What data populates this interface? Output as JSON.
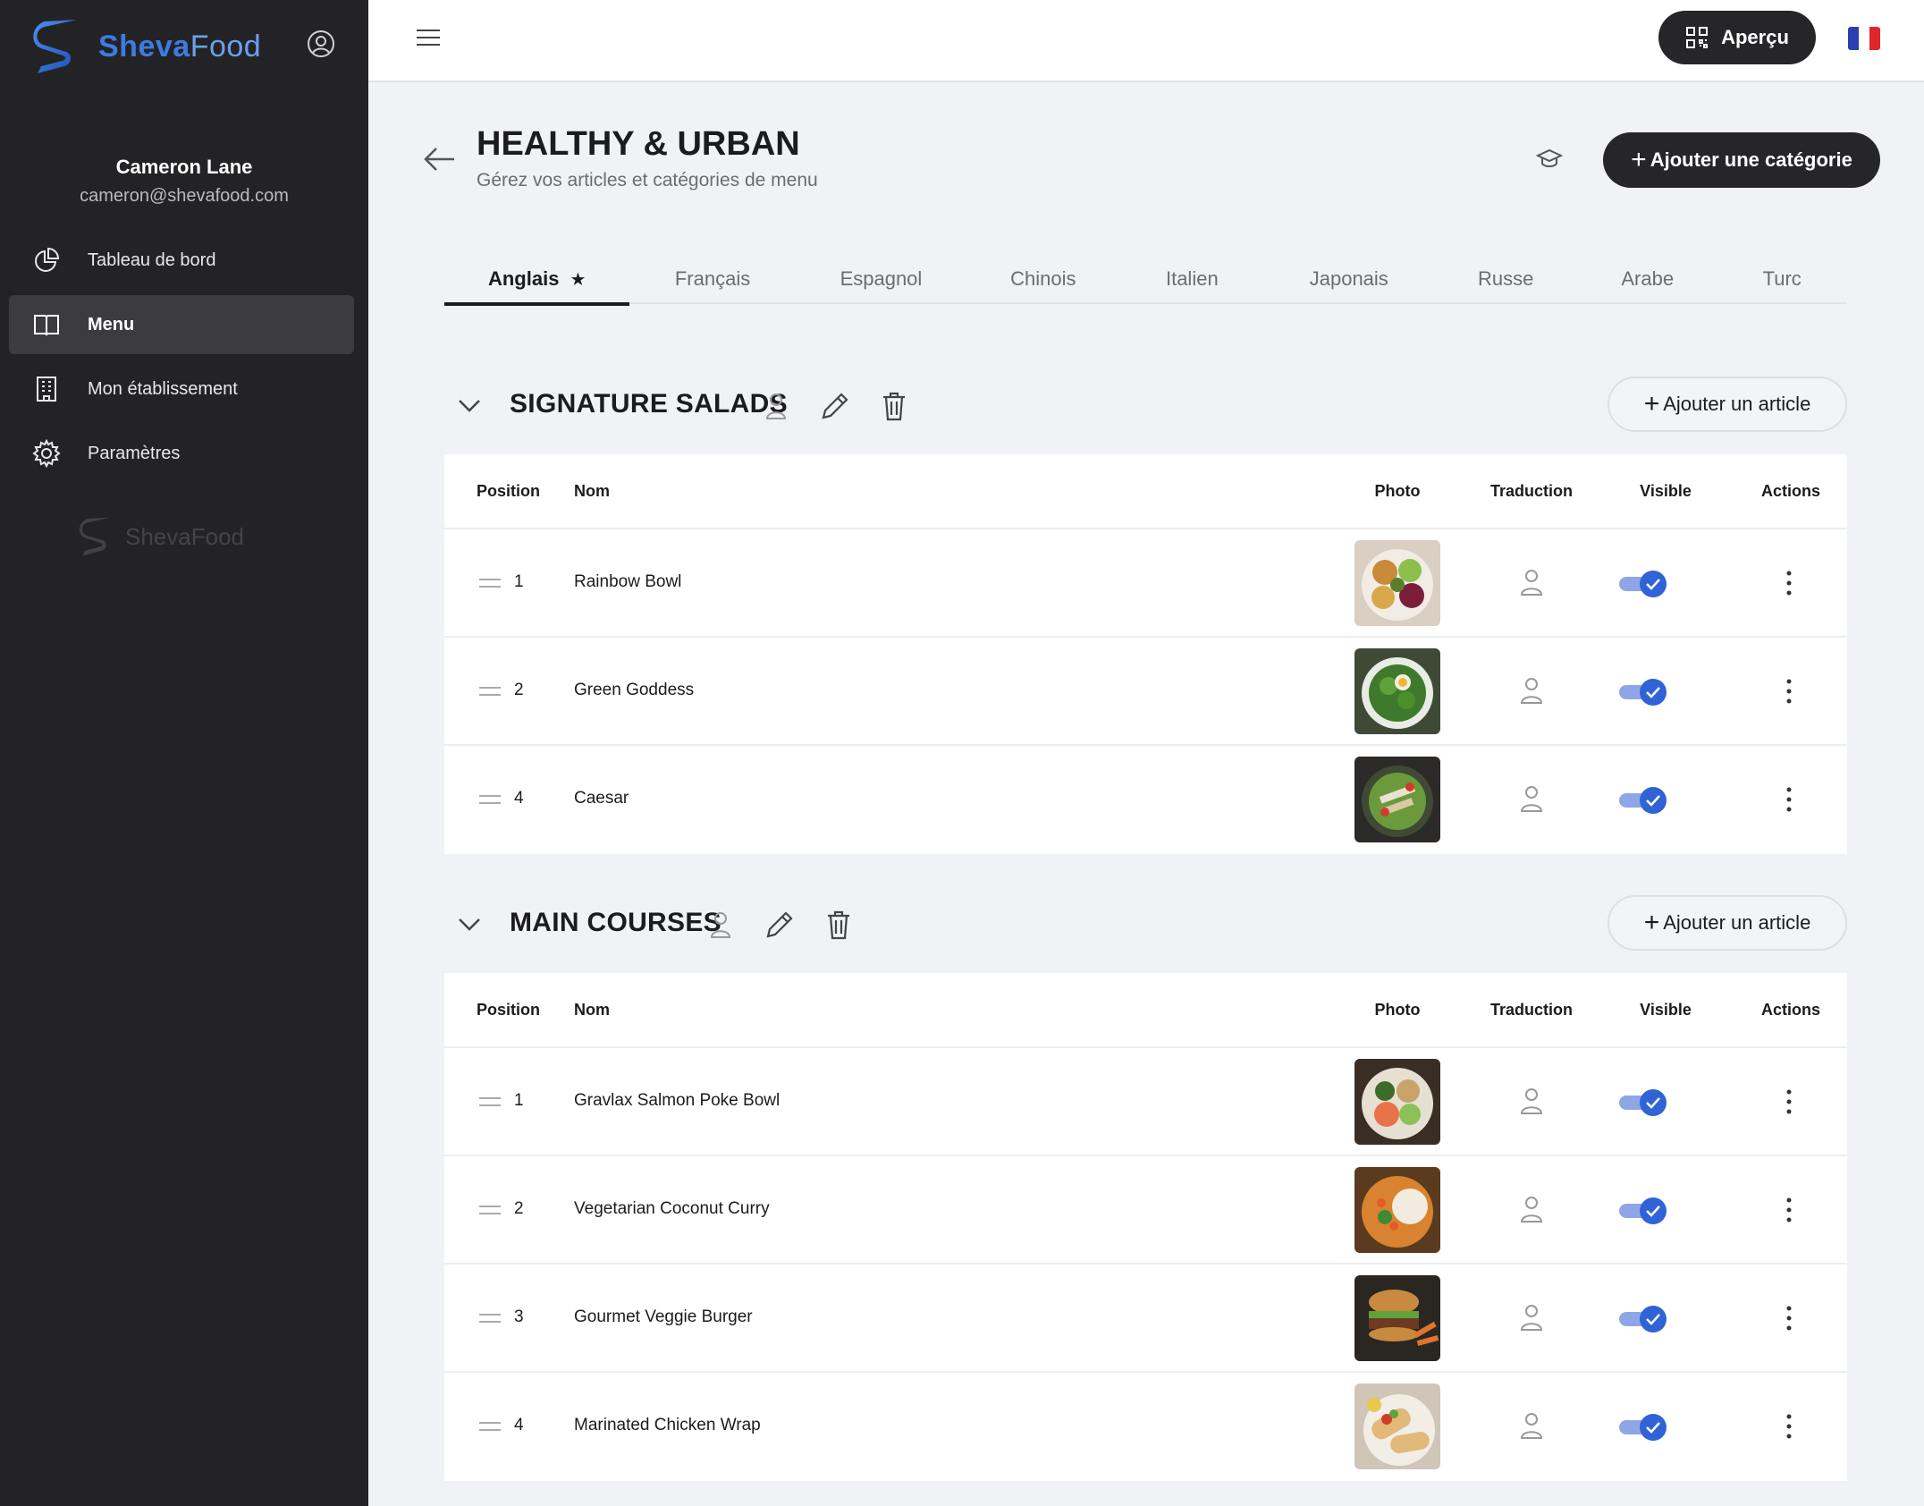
{
  "brand": {
    "name_part1": "Sheva",
    "name_part2": "Food"
  },
  "user": {
    "name": "Cameron Lane",
    "email": "cameron@shevafood.com"
  },
  "nav": [
    {
      "label": "Tableau de bord",
      "icon": "pie-chart-icon",
      "active": false
    },
    {
      "label": "Menu",
      "icon": "book-icon",
      "active": true
    },
    {
      "label": "Mon établissement",
      "icon": "building-icon",
      "active": false
    },
    {
      "label": "Paramètres",
      "icon": "gear-icon",
      "active": false
    }
  ],
  "topbar": {
    "preview_label": "Aperçu",
    "language_flag": "fr"
  },
  "header": {
    "title": "HEALTHY & URBAN",
    "subtitle": "Gérez vos articles et catégories de menu",
    "add_category_label": "Ajouter une catégorie"
  },
  "tabs": [
    {
      "label": "Anglais",
      "active": true,
      "default_star": "★"
    },
    {
      "label": "Français"
    },
    {
      "label": "Espagnol"
    },
    {
      "label": "Chinois"
    },
    {
      "label": "Italien"
    },
    {
      "label": "Japonais"
    },
    {
      "label": "Russe"
    },
    {
      "label": "Arabe"
    },
    {
      "label": "Turc"
    }
  ],
  "table_headers": {
    "position": "Position",
    "name": "Nom",
    "photo": "Photo",
    "translation": "Traduction",
    "visible": "Visible",
    "actions": "Actions"
  },
  "add_article_label": "Ajouter un article",
  "sections": [
    {
      "title": "SIGNATURE SALADS",
      "items": [
        {
          "position": "1",
          "name": "Rainbow Bowl",
          "visible": true
        },
        {
          "position": "2",
          "name": "Green Goddess",
          "visible": true
        },
        {
          "position": "4",
          "name": "Caesar",
          "visible": true
        }
      ]
    },
    {
      "title": "MAIN COURSES",
      "items": [
        {
          "position": "1",
          "name": "Gravlax Salmon Poke Bowl",
          "visible": true
        },
        {
          "position": "2",
          "name": "Vegetarian Coconut Curry",
          "visible": true
        },
        {
          "position": "3",
          "name": "Gourmet Veggie Burger",
          "visible": true
        },
        {
          "position": "4",
          "name": "Marinated Chicken Wrap",
          "visible": true
        }
      ]
    }
  ],
  "colors": {
    "sidebar_bg": "#232325",
    "dark_button": "#262628",
    "toggle_track": "#8fa6e6",
    "toggle_knob": "#2f63d6",
    "brand_blue": "#3d7be3"
  }
}
